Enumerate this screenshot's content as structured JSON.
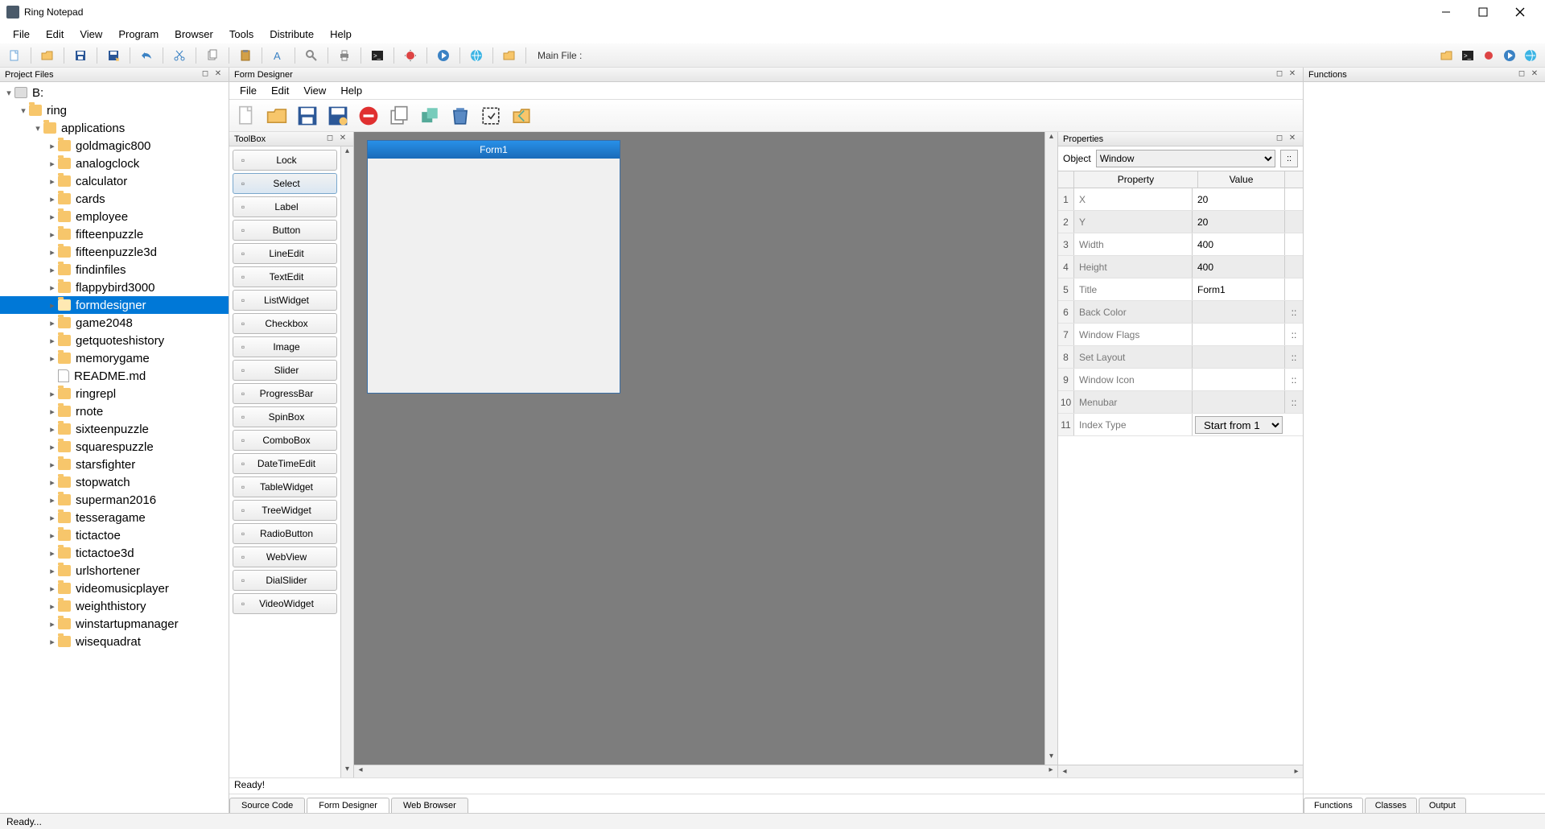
{
  "window": {
    "title": "Ring Notepad"
  },
  "menu": [
    "File",
    "Edit",
    "View",
    "Program",
    "Browser",
    "Tools",
    "Distribute",
    "Help"
  ],
  "toolbar": {
    "mainfile_label": "Main File :"
  },
  "statusbar": {
    "text": "Ready..."
  },
  "project_files": {
    "title": "Project Files",
    "drive": "B:",
    "root": "ring",
    "folder": "applications",
    "selected": "formdesigner",
    "items": [
      {
        "name": "goldmagic800",
        "type": "folder"
      },
      {
        "name": "analogclock",
        "type": "folder"
      },
      {
        "name": "calculator",
        "type": "folder"
      },
      {
        "name": "cards",
        "type": "folder"
      },
      {
        "name": "employee",
        "type": "folder"
      },
      {
        "name": "fifteenpuzzle",
        "type": "folder"
      },
      {
        "name": "fifteenpuzzle3d",
        "type": "folder"
      },
      {
        "name": "findinfiles",
        "type": "folder"
      },
      {
        "name": "flappybird3000",
        "type": "folder"
      },
      {
        "name": "formdesigner",
        "type": "folder"
      },
      {
        "name": "game2048",
        "type": "folder"
      },
      {
        "name": "getquoteshistory",
        "type": "folder"
      },
      {
        "name": "memorygame",
        "type": "folder"
      },
      {
        "name": "README.md",
        "type": "file"
      },
      {
        "name": "ringrepl",
        "type": "folder"
      },
      {
        "name": "rnote",
        "type": "folder"
      },
      {
        "name": "sixteenpuzzle",
        "type": "folder"
      },
      {
        "name": "squarespuzzle",
        "type": "folder"
      },
      {
        "name": "starsfighter",
        "type": "folder"
      },
      {
        "name": "stopwatch",
        "type": "folder"
      },
      {
        "name": "superman2016",
        "type": "folder"
      },
      {
        "name": "tesseragame",
        "type": "folder"
      },
      {
        "name": "tictactoe",
        "type": "folder"
      },
      {
        "name": "tictactoe3d",
        "type": "folder"
      },
      {
        "name": "urlshortener",
        "type": "folder"
      },
      {
        "name": "videomusicplayer",
        "type": "folder"
      },
      {
        "name": "weighthistory",
        "type": "folder"
      },
      {
        "name": "winstartupmanager",
        "type": "folder"
      },
      {
        "name": "wisequadrat",
        "type": "folder"
      }
    ]
  },
  "form_designer": {
    "title": "Form Designer",
    "menu": [
      "File",
      "Edit",
      "View",
      "Help"
    ],
    "status": "Ready!",
    "tabs": [
      "Source Code",
      "Form Designer",
      "Web Browser"
    ],
    "active_tab": "Form Designer",
    "form": {
      "title": "Form1"
    }
  },
  "toolbox": {
    "title": "ToolBox",
    "selected": "Select",
    "items": [
      "Lock",
      "Select",
      "Label",
      "Button",
      "LineEdit",
      "TextEdit",
      "ListWidget",
      "Checkbox",
      "Image",
      "Slider",
      "ProgressBar",
      "SpinBox",
      "ComboBox",
      "DateTimeEdit",
      "TableWidget",
      "TreeWidget",
      "RadioButton",
      "WebView",
      "DialSlider",
      "VideoWidget"
    ]
  },
  "properties": {
    "title": "Properties",
    "object_label": "Object",
    "object_value": "Window",
    "columns": [
      "Property",
      "Value"
    ],
    "rows": [
      {
        "n": 1,
        "name": "X",
        "value": "20",
        "btn": false
      },
      {
        "n": 2,
        "name": "Y",
        "value": "20",
        "btn": false
      },
      {
        "n": 3,
        "name": "Width",
        "value": "400",
        "btn": false
      },
      {
        "n": 4,
        "name": "Height",
        "value": "400",
        "btn": false
      },
      {
        "n": 5,
        "name": "Title",
        "value": "Form1",
        "btn": false
      },
      {
        "n": 6,
        "name": "Back Color",
        "value": "",
        "btn": true
      },
      {
        "n": 7,
        "name": "Window Flags",
        "value": "",
        "btn": true
      },
      {
        "n": 8,
        "name": "Set Layout",
        "value": "",
        "btn": true
      },
      {
        "n": 9,
        "name": "Window Icon",
        "value": "",
        "btn": true
      },
      {
        "n": 10,
        "name": "Menubar",
        "value": "",
        "btn": true
      },
      {
        "n": 11,
        "name": "Index Type",
        "value": "Start from 1",
        "btn": false,
        "select": true
      }
    ]
  },
  "functions": {
    "title": "Functions",
    "tabs": [
      "Functions",
      "Classes",
      "Output"
    ],
    "active_tab": "Functions"
  }
}
